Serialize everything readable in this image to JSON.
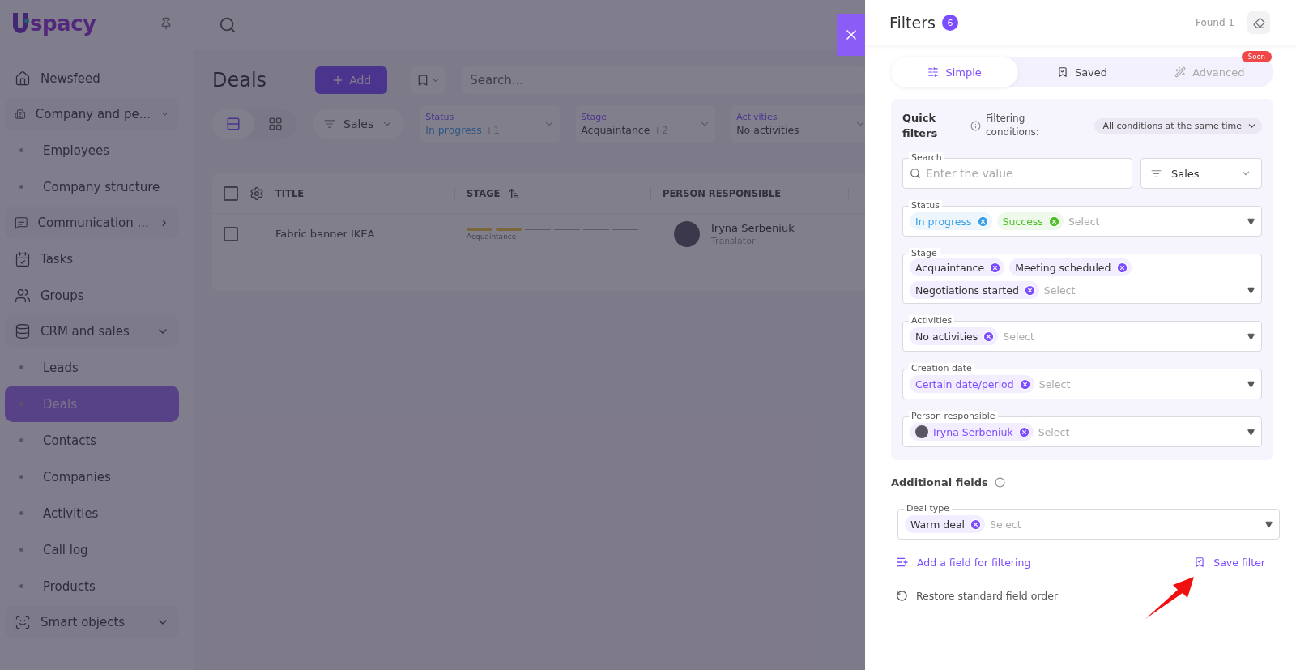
{
  "sidebar": {
    "logo_text": "spacy",
    "items": [
      {
        "label": "Newsfeed",
        "kind": "link",
        "selected": false
      },
      {
        "label": "Company and pe...",
        "kind": "group",
        "expanded": true,
        "selected": false
      },
      {
        "label": "Employees",
        "kind": "sub",
        "selected": false
      },
      {
        "label": "Company structure",
        "kind": "sub",
        "selected": false
      },
      {
        "label": "Communication ...",
        "kind": "group",
        "expanded": false,
        "selected": false
      },
      {
        "label": "Tasks",
        "kind": "link",
        "selected": false
      },
      {
        "label": "Groups",
        "kind": "link",
        "selected": false
      },
      {
        "label": "CRM and sales",
        "kind": "group",
        "expanded": true,
        "selected": false
      },
      {
        "label": "Leads",
        "kind": "sub",
        "selected": false
      },
      {
        "label": "Deals",
        "kind": "sub",
        "selected": true
      },
      {
        "label": "Contacts",
        "kind": "sub",
        "selected": false
      },
      {
        "label": "Companies",
        "kind": "sub",
        "selected": false
      },
      {
        "label": "Activities",
        "kind": "sub",
        "selected": false
      },
      {
        "label": "Call log",
        "kind": "sub",
        "selected": false
      },
      {
        "label": "Products",
        "kind": "sub",
        "selected": false
      },
      {
        "label": "Smart objects",
        "kind": "group",
        "expanded": true,
        "selected": false
      }
    ]
  },
  "main": {
    "title": "Deals",
    "add_button": "Add",
    "search": {
      "placeholder": "Search..."
    },
    "views": [
      {
        "kind": "list",
        "selected": true
      },
      {
        "kind": "grid",
        "selected": false
      }
    ],
    "pipeline": "Sales",
    "filter_chips": [
      {
        "label": "Status",
        "value": "In progress",
        "extra": "+1",
        "kind": "status"
      },
      {
        "label": "Stage",
        "value": "Acquaintance",
        "extra": "+2",
        "kind": "plain"
      },
      {
        "label": "Activities",
        "value": "No activities",
        "kind": "plain"
      }
    ],
    "table": {
      "all_checked": false,
      "columns": [
        "TITLE",
        "STAGE",
        "PERSON RESPONSIBLE"
      ],
      "rows": [
        {
          "title": "Fabric banner IKEA",
          "stage": "Acquaintance",
          "stage_segments": [
            {
              "filled": true
            },
            {
              "filled": true
            },
            {
              "filled": false
            },
            {
              "filled": false
            },
            {
              "filled": false
            },
            {
              "filled": false
            }
          ],
          "person": "Iryna Serbeniuk",
          "role": "Translator",
          "checked": false
        }
      ]
    }
  },
  "filters": {
    "title": "Filters",
    "count": "6",
    "found": "Found 1",
    "tabs": [
      {
        "label": "Simple",
        "selected": true,
        "disabled": false
      },
      {
        "label": "Saved",
        "selected": false,
        "disabled": false
      },
      {
        "label": "Advanced",
        "selected": false,
        "disabled": true,
        "badge": "Soon"
      }
    ],
    "quick": {
      "title": "Quick filters",
      "conditions_label": "Filtering conditions:",
      "conditions_value": "All conditions at the same time",
      "search": {
        "label": "Search",
        "placeholder": "Enter the value"
      },
      "pipeline": "Sales",
      "fields": [
        {
          "label": "Status",
          "placeholder": "Select",
          "tags": [
            {
              "label": "In progress",
              "kind": "colored",
              "color": "#3b9fe6"
            },
            {
              "label": "Success",
              "kind": "colored",
              "color": "#4fbf26"
            }
          ]
        },
        {
          "label": "Stage",
          "placeholder": "Select",
          "tags": [
            {
              "label": "Acquaintance",
              "kind": "plain",
              "color": "#7c4dff"
            },
            {
              "label": "Meeting scheduled",
              "kind": "plain",
              "color": "#7c4dff"
            },
            {
              "label": "Negotiations started",
              "kind": "plain",
              "color": "#7c4dff"
            }
          ]
        },
        {
          "label": "Activities",
          "placeholder": "Select",
          "tags": [
            {
              "label": "No activities",
              "kind": "plain",
              "color": "#7c4dff"
            }
          ]
        },
        {
          "label": "Creation date",
          "placeholder": "Select",
          "tags": [
            {
              "label": "Certain date/period",
              "kind": "colored",
              "color": "#7c4dff"
            }
          ]
        },
        {
          "label": "Person responsible",
          "placeholder": "Select",
          "tags": [
            {
              "label": "Iryna Serbeniuk",
              "kind": "person",
              "color": "#7c4dff"
            }
          ]
        }
      ]
    },
    "additional": {
      "title": "Additional fields",
      "fields": [
        {
          "label": "Deal type",
          "placeholder": "Select",
          "tags": [
            {
              "label": "Warm deal",
              "kind": "plain",
              "color": "#7c4dff"
            }
          ]
        }
      ]
    },
    "add_field": "Add a field for filtering",
    "save_filter": "Save filter",
    "restore": "Restore standard field order"
  }
}
